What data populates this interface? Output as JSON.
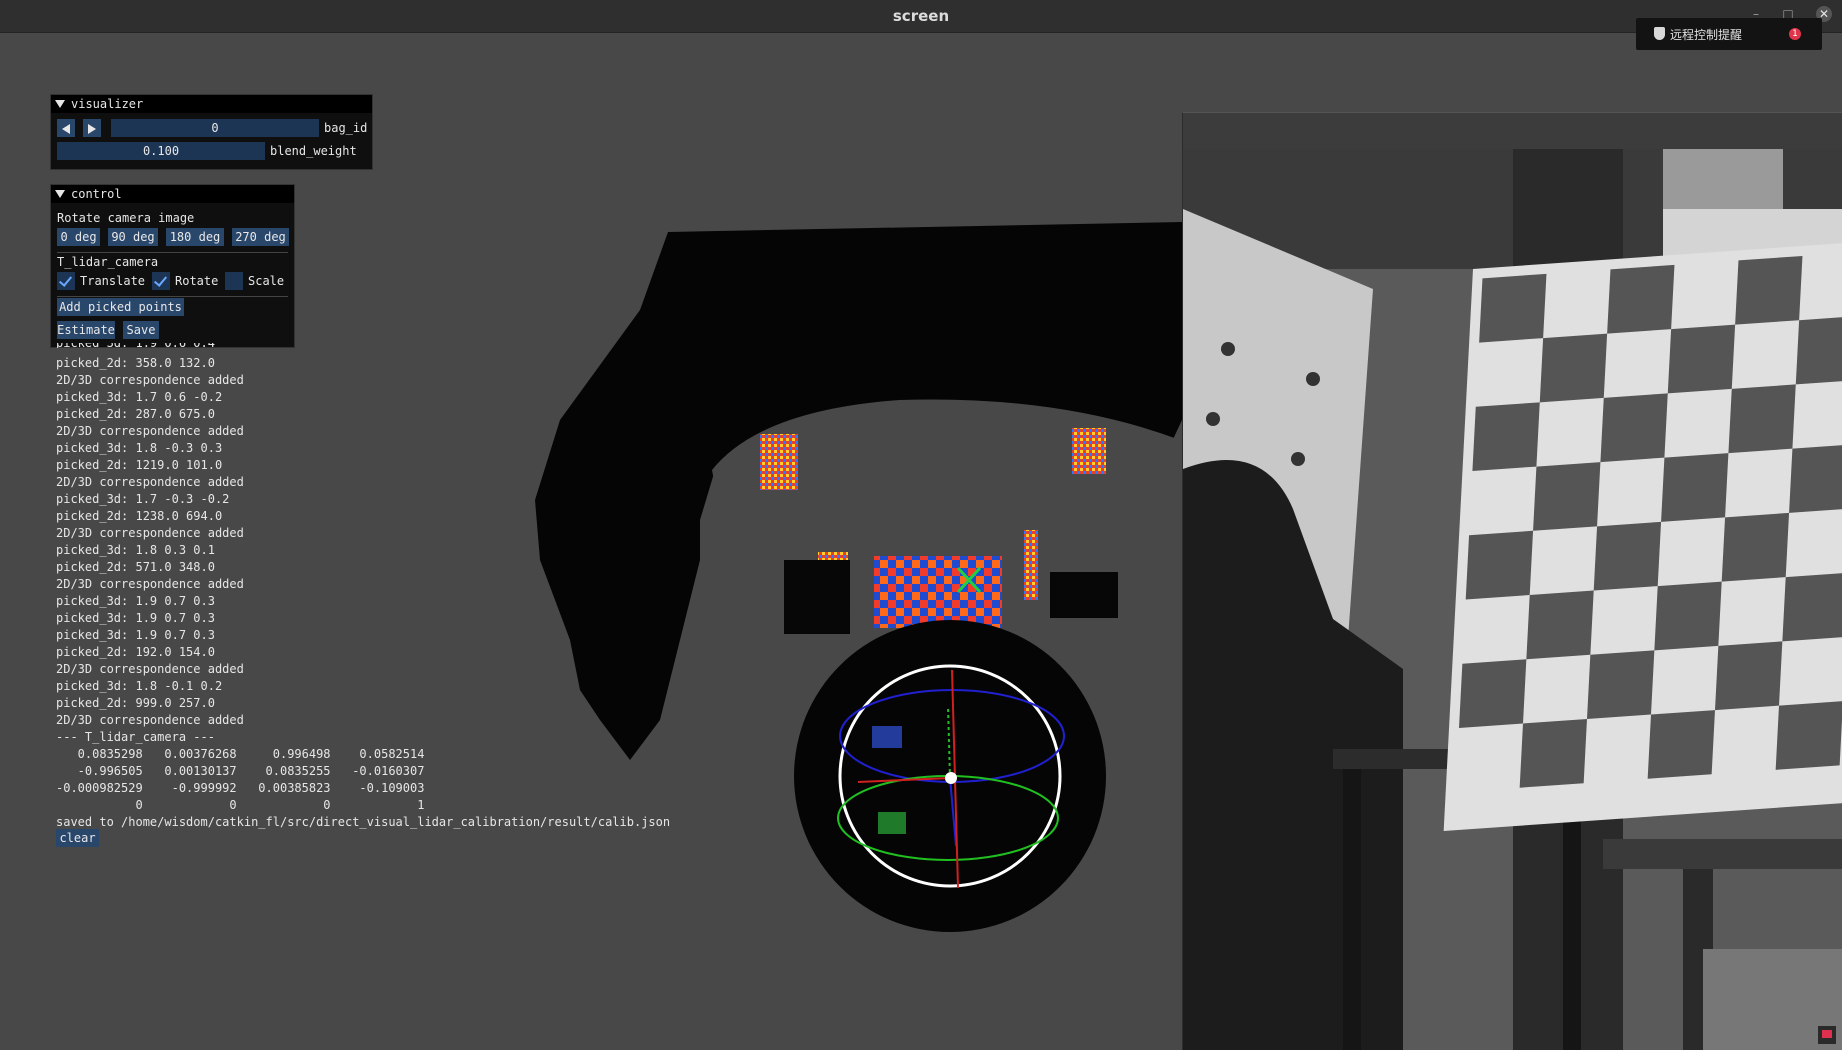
{
  "window": {
    "title": "screen"
  },
  "notification": {
    "text": "远程控制提醒",
    "count": "1"
  },
  "visualizer": {
    "title": "visualizer",
    "bag_id_value": "0",
    "bag_id_label": "bag_id",
    "blend_weight_value": "0.100",
    "blend_weight_label": "blend_weight"
  },
  "control": {
    "title": "control",
    "rotate_label": "Rotate camera image",
    "rotate_buttons": [
      "0 deg",
      "90 deg",
      "180 deg",
      "270 deg"
    ],
    "t_label": "T_lidar_camera",
    "translate_label": "Translate",
    "translate_checked": true,
    "rotate_check_label": "Rotate",
    "rotate_checked": true,
    "scale_label": "Scale",
    "scale_checked": false,
    "add_picked_label": "Add picked points",
    "estimate_label": "Estimate",
    "save_label": "Save"
  },
  "log": {
    "partial_first_line": "picked_3d: 1.9 0.6 0.4",
    "lines": [
      "picked_2d: 358.0 132.0",
      "2D/3D correspondence added",
      "picked_3d: 1.7 0.6 -0.2",
      "picked_2d: 287.0 675.0",
      "2D/3D correspondence added",
      "picked_3d: 1.8 -0.3 0.3",
      "picked_2d: 1219.0 101.0",
      "2D/3D correspondence added",
      "picked_3d: 1.7 -0.3 -0.2",
      "picked_2d: 1238.0 694.0",
      "2D/3D correspondence added",
      "picked_3d: 1.8 0.3 0.1",
      "picked_2d: 571.0 348.0",
      "2D/3D correspondence added",
      "picked_3d: 1.9 0.7 0.3",
      "picked_3d: 1.9 0.7 0.3",
      "picked_3d: 1.9 0.7 0.3",
      "picked_2d: 192.0 154.0",
      "2D/3D correspondence added",
      "picked_3d: 1.8 -0.1 0.2",
      "picked_2d: 999.0 257.0",
      "2D/3D correspondence added",
      "--- T_lidar_camera ---",
      "   0.0835298   0.00376268     0.996498    0.0582514",
      "   -0.996505   0.00130137    0.0835255   -0.0160307",
      "-0.000982529    -0.999992   0.00385823    -0.109003",
      "           0            0            0            1",
      "saved to /home/wisdom/catkin_fl/src/direct_visual_lidar_calibration/result/calib.json"
    ],
    "clear_label": "clear"
  },
  "colors": {
    "background": "#484848",
    "panel": "#0f0f0f",
    "button": "#29466b",
    "slider": "#1d3554",
    "gizmo_x": "#d02020",
    "gizmo_y": "#20c020",
    "gizmo_z": "#2020d0"
  },
  "icons": {
    "prev": "triangle-left",
    "next": "triangle-right",
    "collapse": "triangle-down",
    "close": "close-x"
  }
}
